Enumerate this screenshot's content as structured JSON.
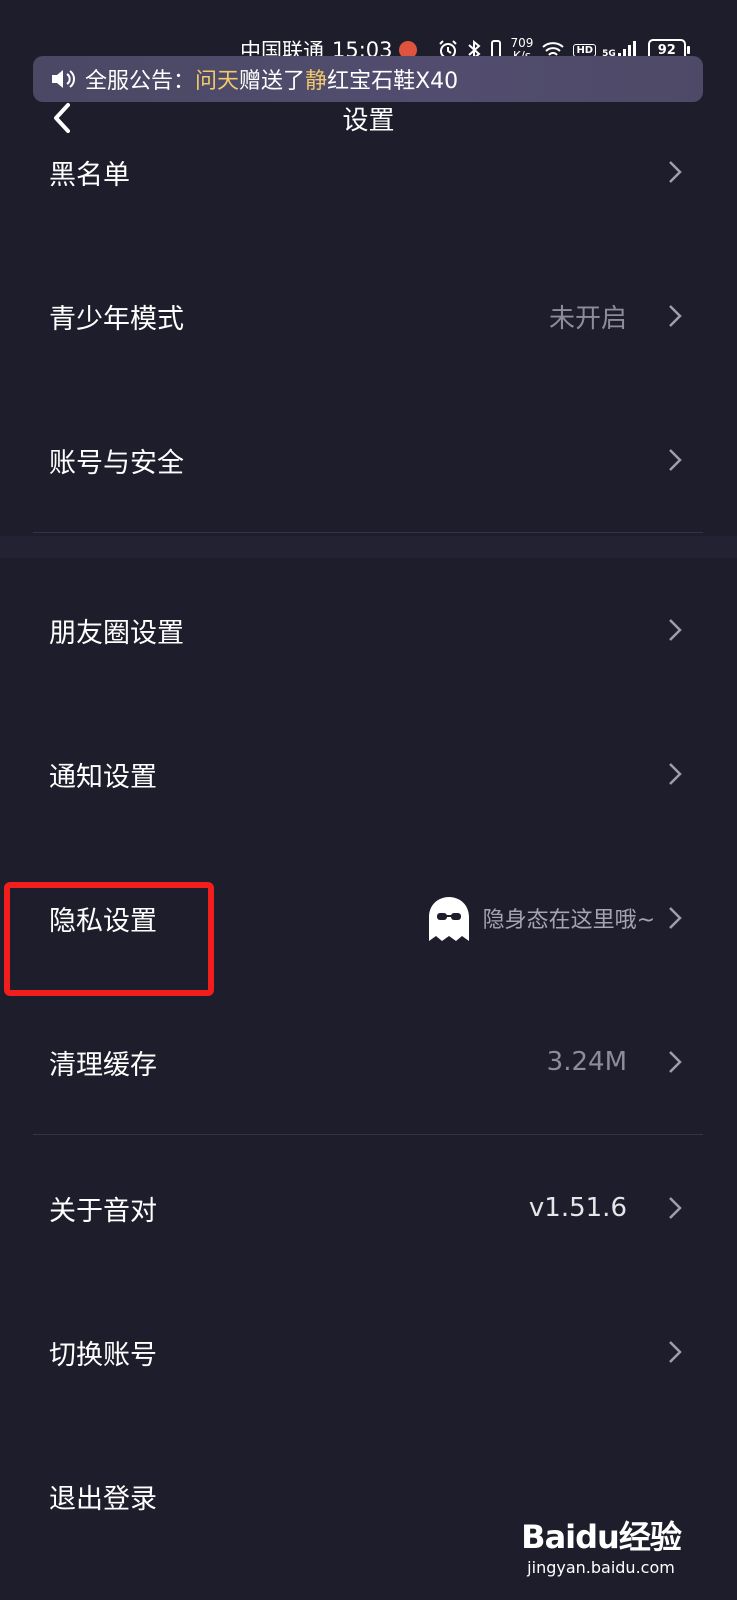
{
  "status_bar": {
    "carrier": "中国联通",
    "time": "15:03",
    "network_speed_value": "709",
    "network_speed_unit": "K/s",
    "hd_label": "HD",
    "signal_label": "5G",
    "battery_level": "92"
  },
  "announcement": {
    "prefix": "全服公告：",
    "sender": "问天",
    "action": "赠送了",
    "receiver": "静",
    "gift": "红宝石鞋X40",
    "highlight_color": "#f2c96b"
  },
  "header": {
    "title": "设置"
  },
  "settings": {
    "blacklist": {
      "label": "黑名单"
    },
    "teen_mode": {
      "label": "青少年模式",
      "value": "未开启"
    },
    "account_security": {
      "label": "账号与安全"
    },
    "moments_settings": {
      "label": "朋友圈设置"
    },
    "notification_settings": {
      "label": "通知设置"
    },
    "privacy_settings": {
      "label": "隐私设置",
      "hint": "隐身态在这里哦~"
    },
    "clear_cache": {
      "label": "清理缓存",
      "value": "3.24M"
    },
    "about": {
      "label": "关于音对",
      "value": "v1.51.6"
    },
    "switch_account": {
      "label": "切换账号"
    },
    "logout": {
      "label": "退出登录"
    }
  },
  "watermark": {
    "brand": "Baidu经验",
    "url": "jingyan.baidu.com"
  },
  "colors": {
    "background": "#1e1d2b",
    "highlight_box": "#f21d1d",
    "secondary_text": "#8d8c9a"
  }
}
